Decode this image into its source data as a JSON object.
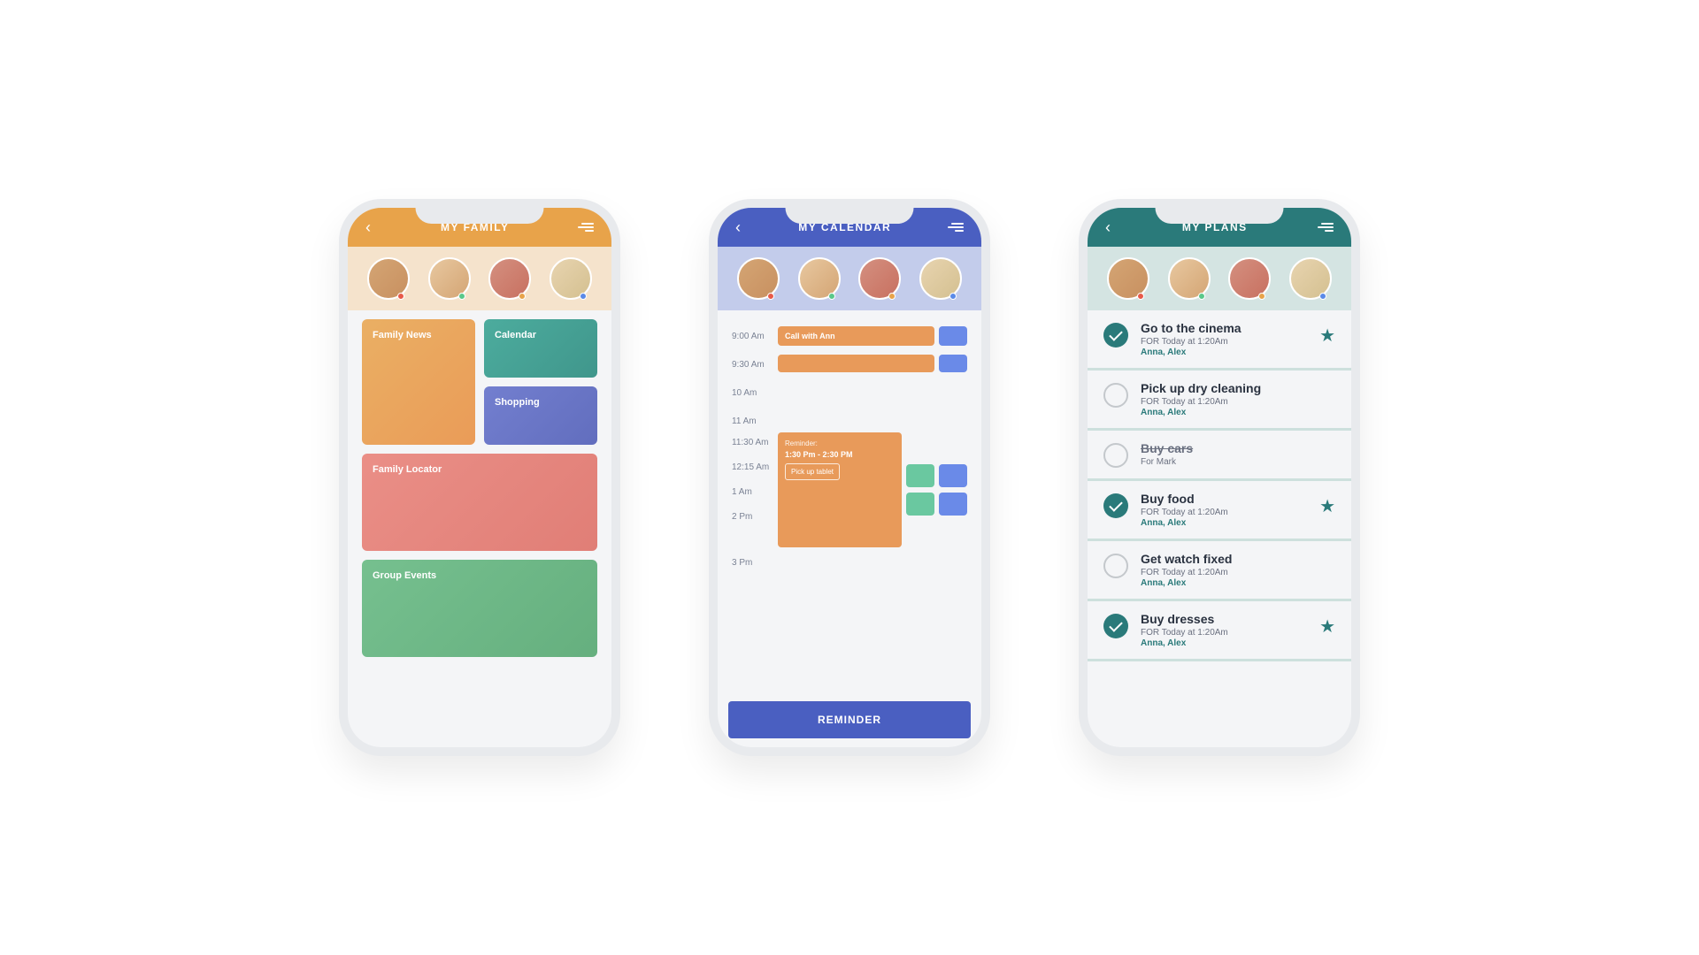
{
  "colors": {
    "orange": "#e8a34a",
    "blue": "#4a5fc1",
    "teal": "#2a7a7a"
  },
  "avatars": [
    {
      "dot": "red"
    },
    {
      "dot": "green"
    },
    {
      "dot": "orange"
    },
    {
      "dot": "blue"
    }
  ],
  "screens": {
    "family": {
      "title": "MY FAMILY",
      "tiles": {
        "news": "Family News",
        "calendar": "Calendar",
        "shopping": "Shopping",
        "locator": "Family Locator",
        "group": "Group Events"
      }
    },
    "calendar": {
      "title": "MY CALENDAR",
      "times": [
        "9:00 Am",
        "9:30 Am",
        "10 Am",
        "11 Am",
        "11:30 Am",
        "12:15 Am",
        "1 Am",
        "2 Pm",
        "3 Pm"
      ],
      "event1": "Call with Ann",
      "reminder": {
        "label": "Reminder:",
        "time": "1:30 Pm - 2:30 PM",
        "action": "Pick up tablet"
      },
      "button": "REMINDER"
    },
    "plans": {
      "title": "MY PLANS",
      "items": [
        {
          "done": true,
          "title": "Go to the cinema",
          "sub": "FOR Today at 1:20Am",
          "who": "Anna, Alex",
          "star": true
        },
        {
          "done": false,
          "title": "Pick up dry cleaning",
          "sub": "FOR Today at 1:20Am",
          "who": "Anna, Alex",
          "star": false
        },
        {
          "done": false,
          "title": "Buy cars",
          "sub": "For Mark",
          "who": "",
          "star": false,
          "strike": true
        },
        {
          "done": true,
          "title": "Buy food",
          "sub": "FOR Today at 1:20Am",
          "who": "Anna, Alex",
          "star": true
        },
        {
          "done": false,
          "title": "Get watch fixed",
          "sub": "FOR Today at 1:20Am",
          "who": "Anna, Alex",
          "star": false
        },
        {
          "done": true,
          "title": "Buy dresses",
          "sub": "FOR Today at 1:20Am",
          "who": "Anna, Alex",
          "star": true
        }
      ]
    }
  }
}
